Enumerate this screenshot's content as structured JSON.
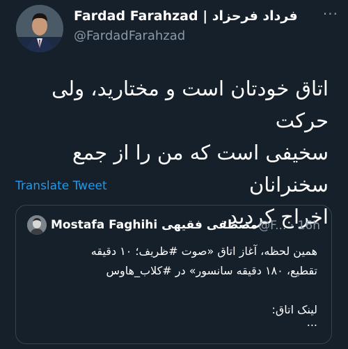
{
  "author": {
    "display_name": "Fardad Farahzad | فرداد فرحزاد",
    "username": "@FardadFarahzad"
  },
  "tweet": {
    "text": "اتاق خودتان است و مختارید، ولی حرکت\nسخیفی است که من را  از جمع سخنرانان\nاخراج کردید."
  },
  "actions": {
    "translate_label": "Translate Tweet",
    "more_label": "···"
  },
  "quoted": {
    "name": "Mostafa Faghihi مصطفی فقیهی",
    "handle": "@F...",
    "separator": "·",
    "time": "16h",
    "text": "همین لحظه، آغاز اتاق «صوت #ظریف؛ ۱۰ دقیقه\nتقطیع، ۱۸۰ دقیقه سانسور» در #کلاب_هاوس\n\nلینک اتاق:",
    "ellipsis": "..."
  },
  "colors": {
    "background": "#15202b",
    "text": "#ffffff",
    "secondary": "#8b98a5",
    "link": "#1d9bf0",
    "border": "#38444d"
  }
}
